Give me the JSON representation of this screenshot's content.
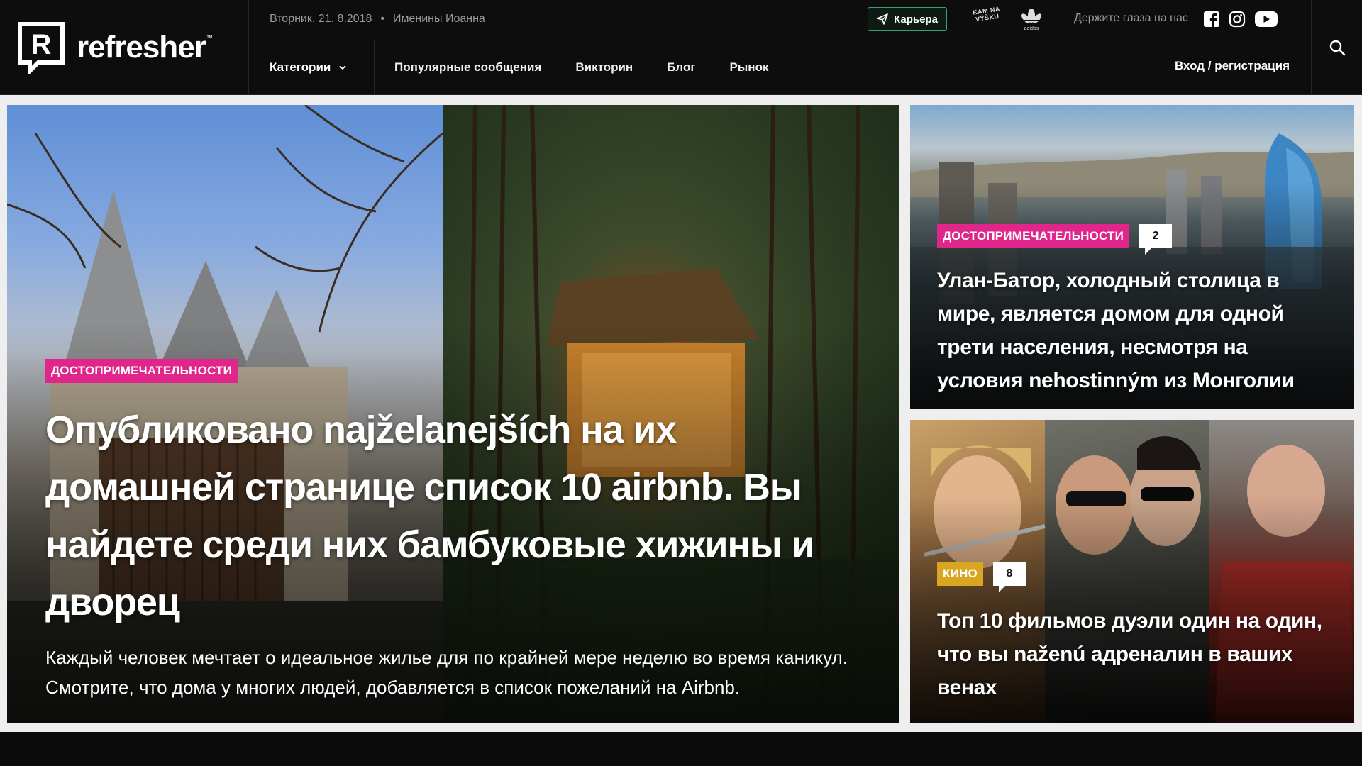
{
  "brand": {
    "name": "refresher",
    "trademark": "™"
  },
  "topbar": {
    "date": "Вторник, 21. 8.2018",
    "names": "Именины Иоанна",
    "career_label": "Карьера",
    "partner1_lines": [
      "KAM NA",
      "VÝŠKU"
    ],
    "partner2_label": "adidas",
    "follow_label": "Держите глаза на нас",
    "social_icons": [
      "facebook-icon",
      "instagram-icon",
      "youtube-icon"
    ]
  },
  "nav": {
    "categories_label": "Категории",
    "items": [
      "Популярные сообщения",
      "Викторин",
      "Блог",
      "Рынок"
    ],
    "login_label": "Вход / регистрация"
  },
  "hero": {
    "tag": "ДОСТОПРИМЕЧАТЕЛЬНОСТИ",
    "title": "Опубликовано najželanejších на их домашней странице список 10 airbnb. Вы найдете среди них бамбуковые хижины и дворец",
    "lead": "Каждый человек мечтает о идеальное жилье для по крайней мере неделю во время каникул. Смотрите, что дома у многих людей, добавляется в список пожеланий на Airbnb."
  },
  "side_articles": [
    {
      "tag": "ДОСТОПРИМЕЧАТЕЛЬНОСТИ",
      "comments": "2",
      "title": "Улан-Батор, холодный столица в мире, является домом для одной трети населения, несмотря на условия nehostinným из Монголии"
    },
    {
      "tag": "КИНО",
      "comments": "8",
      "title": "Топ 10 фильмов дуэли один на один, что вы naženú адреналин в ваших венах"
    }
  ],
  "colors": {
    "accent_pink": "#e0268a",
    "accent_yellow": "#d9a621",
    "career_border": "#2fa56a",
    "header_bg": "#0d0d0d"
  }
}
